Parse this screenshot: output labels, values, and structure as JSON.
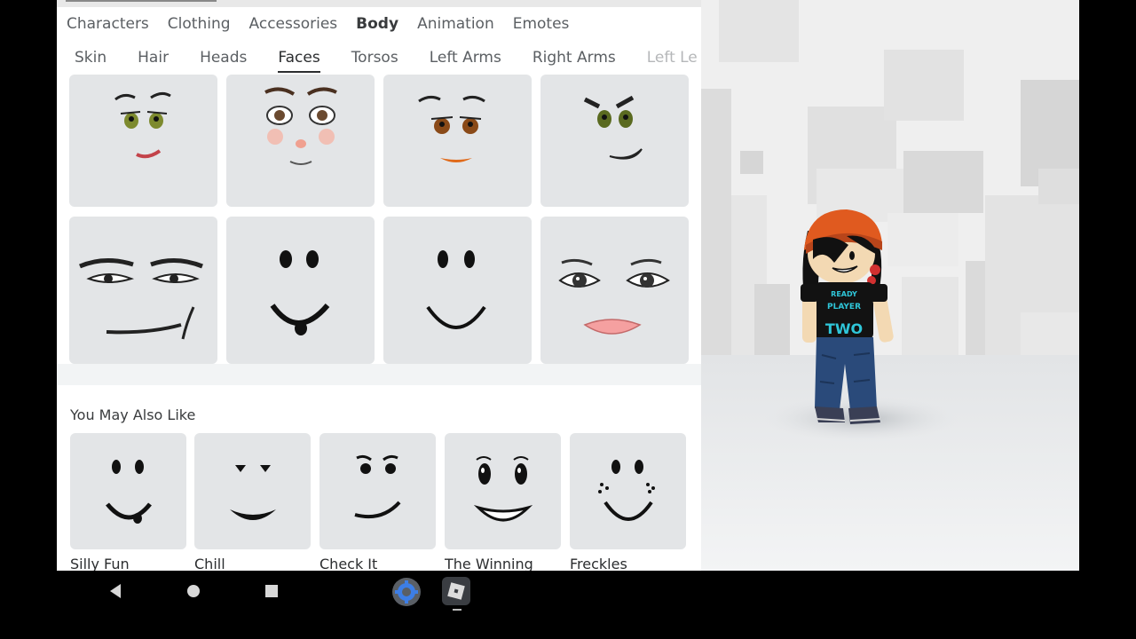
{
  "category_tabs": [
    {
      "label": "Characters"
    },
    {
      "label": "Clothing"
    },
    {
      "label": "Accessories"
    },
    {
      "label": "Body"
    },
    {
      "label": "Animation"
    },
    {
      "label": "Emotes"
    }
  ],
  "active_category": "Body",
  "sub_tabs": [
    {
      "label": "Skin"
    },
    {
      "label": "Hair"
    },
    {
      "label": "Heads"
    },
    {
      "label": "Faces"
    },
    {
      "label": "Torsos"
    },
    {
      "label": "Left Arms"
    },
    {
      "label": "Right Arms"
    },
    {
      "label": "Left Le"
    }
  ],
  "active_sub_tab": "Faces",
  "recommendations": {
    "title": "You May Also Like",
    "items": [
      {
        "label": "Silly Fun"
      },
      {
        "label": "Chill"
      },
      {
        "label": "Check It"
      },
      {
        "label": "The Winning"
      },
      {
        "label": "Freckles"
      }
    ]
  },
  "avatar": {
    "shirt_text": [
      "READY",
      "PLAYER",
      "TWO"
    ],
    "beanie_color": "#e05a1f",
    "shirt_color": "#121212",
    "shirt_text_color": "#2fc6d9",
    "pants_color": "#2a4a7a"
  },
  "icons": {
    "nav_back": "back-triangle-icon",
    "nav_home": "home-circle-icon",
    "nav_recent": "recent-square-icon",
    "dock_settings": "settings-gear-icon",
    "dock_roblox": "roblox-app-icon"
  },
  "colors": {
    "tile_bg": "#e3e5e7",
    "panel_bg": "#ffffff",
    "viewport_bg": "#eeeeee"
  }
}
